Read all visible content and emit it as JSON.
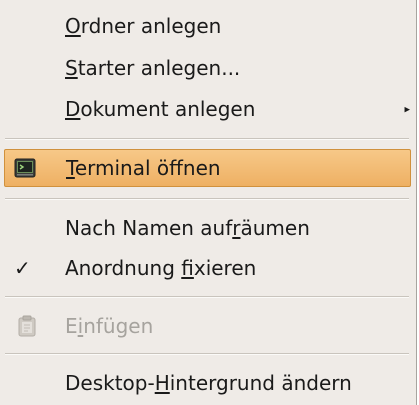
{
  "menu": {
    "items": [
      {
        "before": "",
        "mnemonic": "O",
        "after": "rdner anlegen"
      },
      {
        "before": "",
        "mnemonic": "S",
        "after": "tarter anlegen..."
      },
      {
        "before": "",
        "mnemonic": "D",
        "after": "okument anlegen",
        "submenu_icon": "submenu-arrow-icon"
      },
      {
        "before": "",
        "mnemonic": "T",
        "after": "erminal öffnen",
        "icon": "terminal-icon",
        "highlighted": true
      },
      {
        "before": "Nach Namen auf",
        "mnemonic": "r",
        "after": "äumen"
      },
      {
        "before": "Anordnung ",
        "mnemonic": "f",
        "after": "ixieren",
        "checked": true,
        "check_mark": "✓"
      },
      {
        "before": "E",
        "mnemonic": "i",
        "after": "nfügen",
        "icon": "paste-icon",
        "disabled": true
      },
      {
        "before": "Desktop-",
        "mnemonic": "H",
        "after": "intergrund ändern"
      }
    ]
  },
  "colors": {
    "menu_background": "#efebe7",
    "highlight": "#f2b86e",
    "disabled_text": "#a6a39e"
  }
}
